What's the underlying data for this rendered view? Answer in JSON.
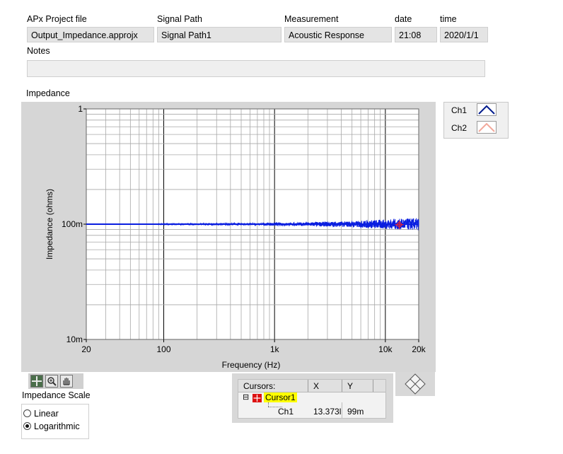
{
  "header": {
    "project_label": "APx Project file",
    "project_value": "Output_Impedance.approjx",
    "signal_path_label": "Signal Path",
    "signal_path_value": "Signal Path1",
    "measurement_label": "Measurement",
    "measurement_value": "Acoustic Response",
    "date_label": "date",
    "date_value": "21:08",
    "time_label": "time",
    "time_value": "2020/1/1",
    "notes_label": "Notes",
    "notes_value": ""
  },
  "graph": {
    "title": "Impedance",
    "legend": [
      {
        "name": "Ch1",
        "color": "#001a8c"
      },
      {
        "name": "Ch2",
        "color": "#f2a89b"
      }
    ],
    "cursor_marker_color": "#e0243a"
  },
  "chart_data": {
    "type": "line",
    "xlabel": "Frequency (Hz)",
    "ylabel": "Impedance (ohms)",
    "xscale": "log",
    "yscale": "log",
    "xlim": [
      20,
      20000
    ],
    "ylim": [
      0.01,
      1
    ],
    "x_tick_labels": [
      "20",
      "100",
      "1k",
      "10k",
      "20k"
    ],
    "y_tick_labels": [
      "1",
      "100m",
      "10m"
    ],
    "grid": true,
    "legend_position": "right",
    "series": [
      {
        "name": "Ch1",
        "color": "#0a1ee0",
        "x": [
          20,
          30,
          50,
          70,
          100,
          150,
          200,
          300,
          500,
          700,
          1000,
          1500,
          2000,
          3000,
          5000,
          7000,
          10000,
          13000,
          16000,
          20000
        ],
        "y": [
          0.1,
          0.1,
          0.1,
          0.1,
          0.1,
          0.1,
          0.1,
          0.1,
          0.1,
          0.1,
          0.1,
          0.1,
          0.1,
          0.1,
          0.1,
          0.1,
          0.1,
          0.1,
          0.1,
          0.1
        ],
        "noise_envelope_ratio": [
          1.0,
          1.0,
          1.0,
          1.0,
          1.01,
          1.01,
          1.01,
          1.02,
          1.02,
          1.02,
          1.03,
          1.03,
          1.04,
          1.05,
          1.06,
          1.08,
          1.1,
          1.11,
          1.12,
          1.13
        ]
      },
      {
        "name": "Ch2",
        "color": "#f2a89b",
        "x": [
          20,
          100,
          1000,
          10000,
          20000
        ],
        "y": [
          0.1,
          0.1,
          0.1,
          0.1,
          0.1
        ]
      }
    ],
    "cursor": {
      "x": 13373,
      "y": 0.099
    }
  },
  "tools": {
    "palette": [
      "cursor-move-icon",
      "zoom-icon",
      "pan-hand-icon"
    ]
  },
  "scale": {
    "label": "Impedance Scale",
    "options": [
      {
        "label": "Linear",
        "selected": false
      },
      {
        "label": "Logarithmic",
        "selected": true
      }
    ]
  },
  "cursors": {
    "header": {
      "name": "Cursors:",
      "x": "X",
      "y": "Y"
    },
    "cursor_name": "Cursor1",
    "cursor_expand_symbol": "⊟",
    "row": {
      "channel": "Ch1",
      "x": "13.373l",
      "y": "99m"
    }
  }
}
